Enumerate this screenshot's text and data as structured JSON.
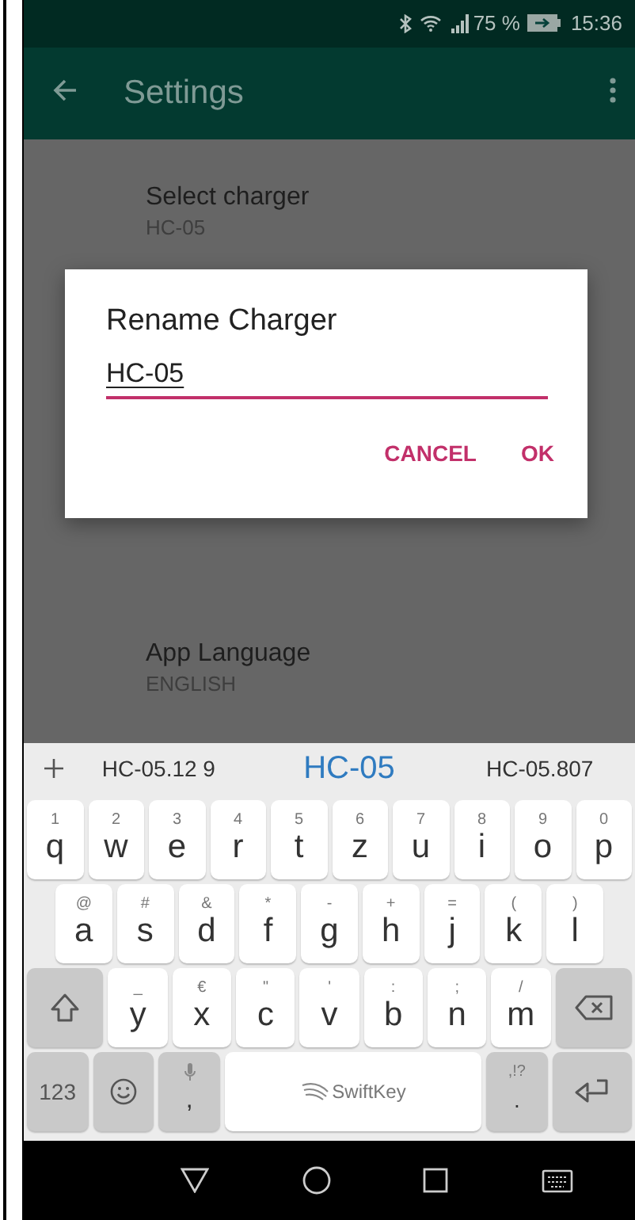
{
  "status_bar": {
    "battery": "75 %",
    "time": "15:36"
  },
  "app_bar": {
    "title": "Settings"
  },
  "settings": [
    {
      "title": "Select charger",
      "value": "HC-05"
    },
    {
      "title": "App Language",
      "value": "ENGLISH"
    }
  ],
  "dialog": {
    "title": "Rename Charger",
    "value": "HC-05",
    "buttons": [
      "CANCEL",
      "OK"
    ]
  },
  "keyboard": {
    "suggestions": [
      {
        "text": "HC-05.12 9",
        "selected": false
      },
      {
        "text": "HC-05",
        "selected": true
      },
      {
        "text": "HC-05.807",
        "selected": false
      }
    ],
    "rows": [
      {
        "keys": [
          {
            "kind": "letter",
            "hint": "1",
            "label": "q"
          },
          {
            "kind": "letter",
            "hint": "2",
            "label": "w"
          },
          {
            "kind": "letter",
            "hint": "3",
            "label": "e"
          },
          {
            "kind": "letter",
            "hint": "4",
            "label": "r"
          },
          {
            "kind": "letter",
            "hint": "5",
            "label": "t"
          },
          {
            "kind": "letter",
            "hint": "6",
            "label": "z"
          },
          {
            "kind": "letter",
            "hint": "7",
            "label": "u"
          },
          {
            "kind": "letter",
            "hint": "8",
            "label": "i"
          },
          {
            "kind": "letter",
            "hint": "9",
            "label": "o"
          },
          {
            "kind": "letter",
            "hint": "0",
            "label": "p"
          }
        ]
      },
      {
        "keys": [
          {
            "kind": "letter",
            "hint": "@",
            "label": "a"
          },
          {
            "kind": "letter",
            "hint": "#",
            "label": "s"
          },
          {
            "kind": "letter",
            "hint": "&",
            "label": "d"
          },
          {
            "kind": "letter",
            "hint": "*",
            "label": "f"
          },
          {
            "kind": "letter",
            "hint": "-",
            "label": "g"
          },
          {
            "kind": "letter",
            "hint": "+",
            "label": "h"
          },
          {
            "kind": "letter",
            "hint": "=",
            "label": "j"
          },
          {
            "kind": "letter",
            "hint": "(",
            "label": "k"
          },
          {
            "kind": "letter",
            "hint": ")",
            "label": "l"
          }
        ]
      },
      {
        "keys": [
          {
            "kind": "shift"
          },
          {
            "kind": "letter",
            "hint": "_",
            "label": "y"
          },
          {
            "kind": "letter",
            "hint": "€",
            "label": "x"
          },
          {
            "kind": "letter",
            "hint": "\"",
            "label": "c"
          },
          {
            "kind": "letter",
            "hint": "'",
            "label": "v"
          },
          {
            "kind": "letter",
            "hint": ":",
            "label": "b"
          },
          {
            "kind": "letter",
            "hint": ";",
            "label": "n"
          },
          {
            "kind": "letter",
            "hint": "/",
            "label": "m"
          },
          {
            "kind": "backspace"
          }
        ]
      },
      {
        "keys": [
          {
            "kind": "symbols",
            "label": "123"
          },
          {
            "kind": "emoji"
          },
          {
            "kind": "mic",
            "label": ","
          },
          {
            "kind": "space",
            "label": "SwiftKey"
          },
          {
            "kind": "punct",
            "hint": ",!?",
            "label": "."
          },
          {
            "kind": "enter"
          }
        ]
      }
    ]
  }
}
